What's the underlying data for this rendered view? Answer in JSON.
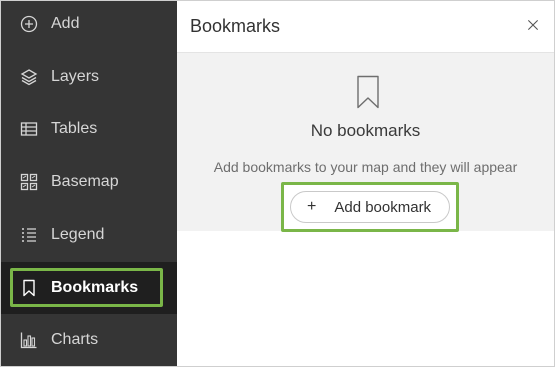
{
  "sidebar": {
    "items": [
      {
        "label": "Add",
        "icon": "plus-circle-icon"
      },
      {
        "label": "Layers",
        "icon": "layers-icon"
      },
      {
        "label": "Tables",
        "icon": "table-icon"
      },
      {
        "label": "Basemap",
        "icon": "basemap-icon"
      },
      {
        "label": "Legend",
        "icon": "legend-icon"
      },
      {
        "label": "Bookmarks",
        "icon": "bookmark-icon",
        "active": true
      },
      {
        "label": "Charts",
        "icon": "chart-icon"
      }
    ]
  },
  "panel": {
    "title": "Bookmarks",
    "close_icon": "close-icon",
    "empty_title": "No bookmarks",
    "empty_desc": "Add bookmarks to your map and they will appear here.",
    "add_button_label": "Add bookmark"
  },
  "colors": {
    "sidebar_bg": "#353535",
    "sidebar_active_bg": "#1f1f1f",
    "highlight": "#7ab648",
    "empty_bg": "#f2f2f2"
  }
}
